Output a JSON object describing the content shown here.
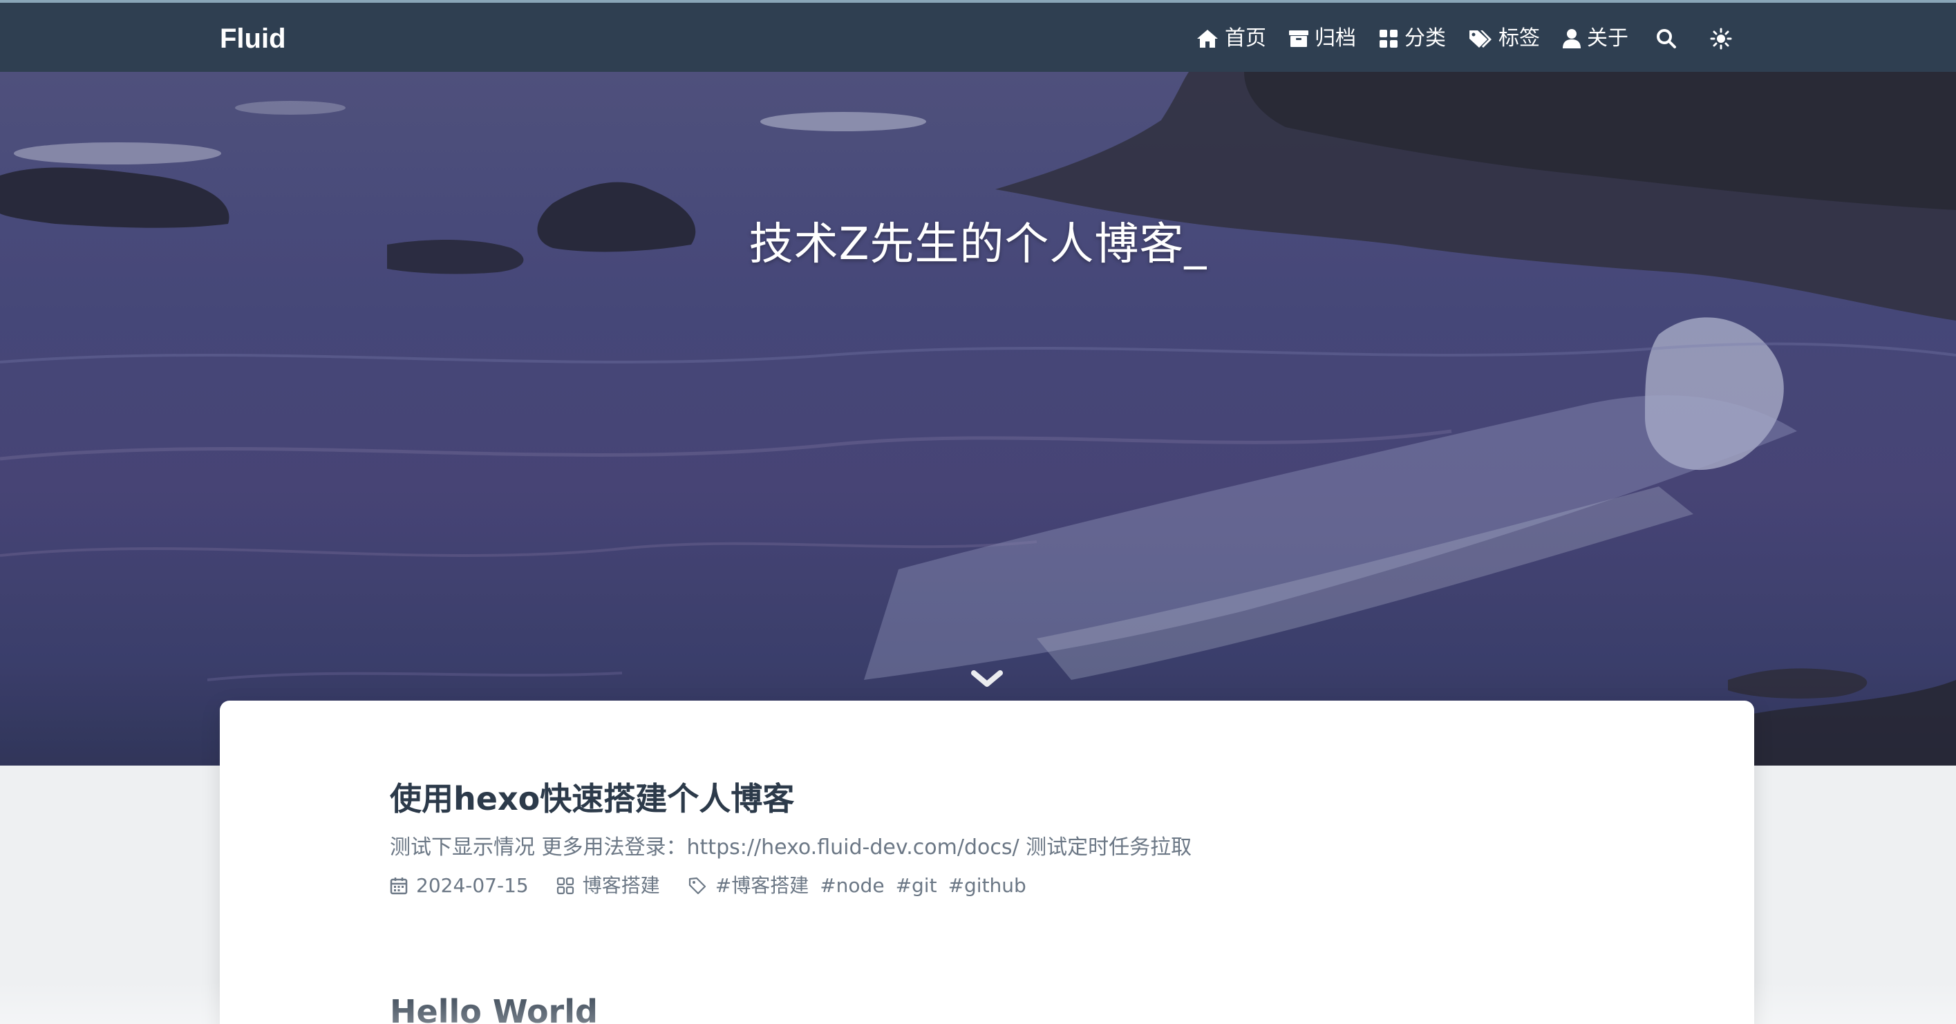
{
  "navbar": {
    "brand": "Fluid",
    "items": [
      {
        "label": "首页",
        "icon": "home-icon"
      },
      {
        "label": "归档",
        "icon": "archive-icon"
      },
      {
        "label": "分类",
        "icon": "category-icon"
      },
      {
        "label": "标签",
        "icon": "tag-icon"
      },
      {
        "label": "关于",
        "icon": "user-icon"
      }
    ],
    "search_icon": "search-icon",
    "theme_icon": "sun-icon"
  },
  "banner": {
    "title": "技术Z先生的个人博客_",
    "scroll_icon": "chevron-down-icon"
  },
  "posts": [
    {
      "title": "使用hexo快速搭建个人博客",
      "excerpt": "测试下显示情况 更多用法登录：https://hexo.fluid-dev.com/docs/ 测试定时任务拉取",
      "date": "2024-07-15",
      "category": "博客搭建",
      "tags": [
        "#博客搭建",
        "#node",
        "#git",
        "#github"
      ]
    },
    {
      "title": "Hello World"
    }
  ],
  "colors": {
    "navbar_bg": "#2f3f51",
    "title_text": "#2c3a4a",
    "muted_text": "#6b7785"
  }
}
